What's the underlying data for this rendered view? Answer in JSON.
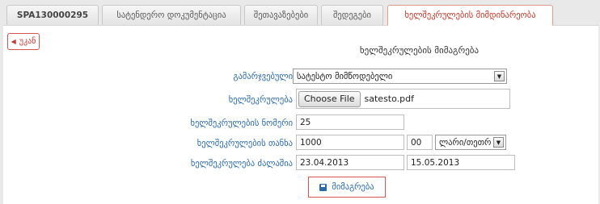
{
  "tabs": [
    {
      "label": "SPA130000295",
      "active": false
    },
    {
      "label": "სატენდერო დოკუმენტაცია",
      "active": false
    },
    {
      "label": "შეთავაზებები",
      "active": false
    },
    {
      "label": "შედეგები",
      "active": false
    },
    {
      "label": "ხელშეკრულების მიმდინარეობა",
      "active": true
    }
  ],
  "back_button": {
    "label": "უკან",
    "icon": "chevron-left-icon"
  },
  "form": {
    "title": "ხელშეკრულების მიმაგრება",
    "winner": {
      "label": "გამარჯვებული",
      "value": "სატესტო მიმწოდებელი"
    },
    "contract": {
      "label": "ხელშეკრულება",
      "button": "Choose File",
      "file": "satesto.pdf"
    },
    "number": {
      "label": "ხელშეკრულების ნომერი",
      "value": "25"
    },
    "amount": {
      "label": "ხელშეკრულების თანხა",
      "value": "1000",
      "cents": "00",
      "currency": "ლარი/თეთრ"
    },
    "validity": {
      "label": "ხელშეკრულება ძალაშია",
      "from": "23.04.2013",
      "to": "15.05.2013"
    },
    "submit": {
      "label": "მიმაგრება",
      "icon": "save-icon"
    }
  },
  "colors": {
    "accent": "#c0392b",
    "label": "#2a6aa8",
    "border_red": "#d9534f"
  }
}
